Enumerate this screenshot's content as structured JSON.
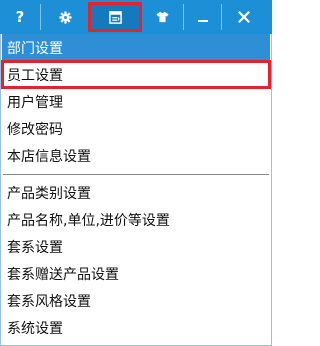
{
  "toolbar": {
    "buttons": [
      {
        "icon": "help-icon",
        "glyph": "?"
      },
      {
        "icon": "gear-icon"
      },
      {
        "icon": "settings-window-icon",
        "selected": true
      },
      {
        "icon": "shirt-icon"
      },
      {
        "icon": "minimize-icon"
      },
      {
        "icon": "close-icon"
      }
    ],
    "colors": {
      "bar": "#1c8fd6",
      "highlight_box": "#e8222d",
      "menu_active": "#2f8fd6"
    }
  },
  "menu": {
    "group1": [
      {
        "label": "部门设置",
        "state": "hovered"
      },
      {
        "label": "员工设置",
        "state": "annotated"
      },
      {
        "label": "用户管理"
      },
      {
        "label": "修改密码"
      },
      {
        "label": "本店信息设置"
      }
    ],
    "group2": [
      {
        "label": "产品类别设置"
      },
      {
        "label": "产品名称,单位,进价等设置"
      },
      {
        "label": "套系设置"
      },
      {
        "label": "套系赠送产品设置"
      },
      {
        "label": "套系风格设置"
      },
      {
        "label": "系统设置"
      }
    ]
  }
}
